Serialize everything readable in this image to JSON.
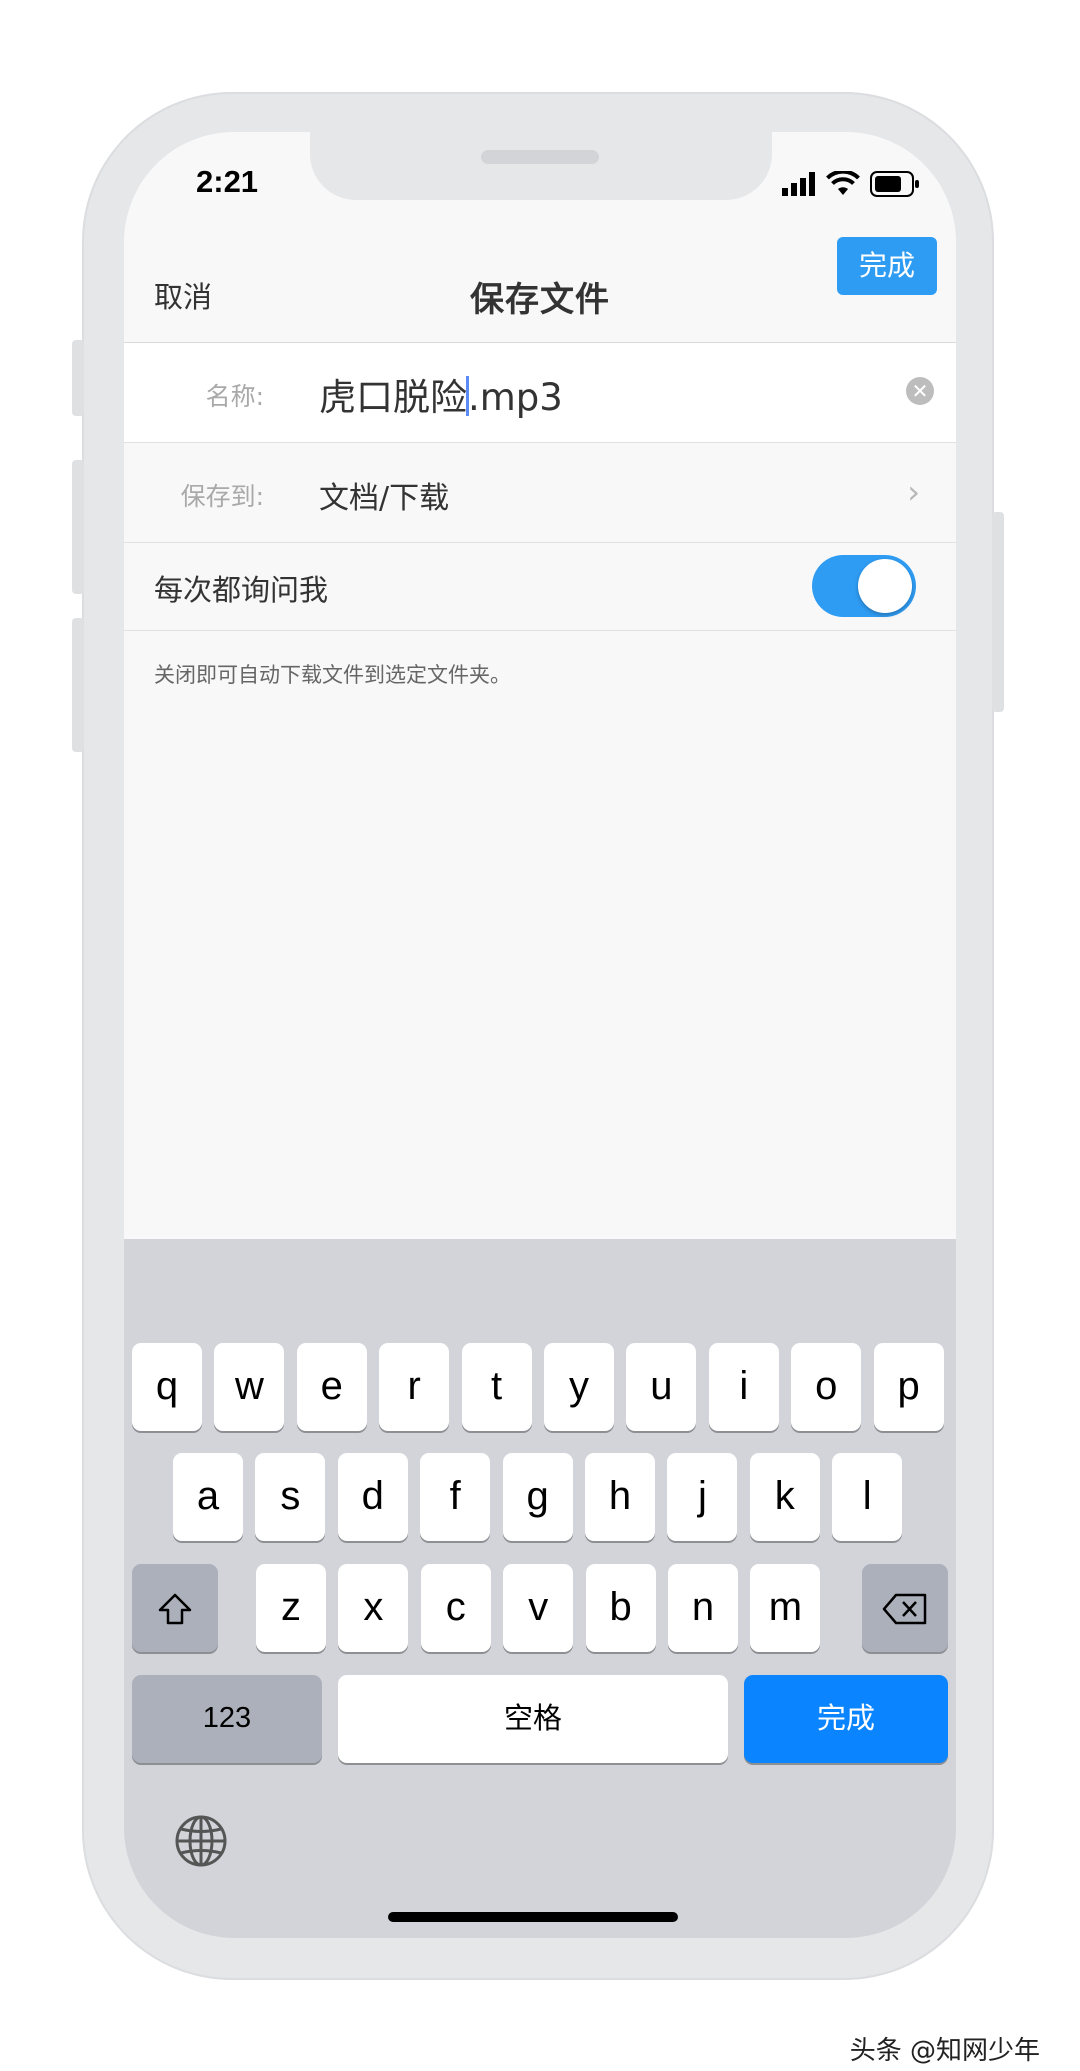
{
  "status_bar": {
    "time": "2:21",
    "icons": [
      "signal-icon",
      "wifi-icon",
      "battery-icon"
    ]
  },
  "nav": {
    "cancel": "取消",
    "title": "保存文件",
    "done": "完成",
    "done_color": "#2f9cf3"
  },
  "form": {
    "name_label": "名称:",
    "name_value_before_cursor": "虎口脱险",
    "name_value_after_cursor": ".mp3",
    "path_label": "保存到:",
    "path_value": "文档/下载",
    "ask_label": "每次都询问我",
    "ask_toggle_on": true,
    "hint": "关闭即可自动下载文件到选定文件夹。"
  },
  "keyboard": {
    "row1": [
      "q",
      "w",
      "e",
      "r",
      "t",
      "y",
      "u",
      "i",
      "o",
      "p"
    ],
    "row2": [
      "a",
      "s",
      "d",
      "f",
      "g",
      "h",
      "j",
      "k",
      "l"
    ],
    "row3": [
      "z",
      "x",
      "c",
      "v",
      "b",
      "n",
      "m"
    ],
    "numbers_key": "123",
    "space_key": "空格",
    "done_key": "完成",
    "done_key_color": "#0a84ff"
  },
  "watermark": "头条 @知网少年"
}
